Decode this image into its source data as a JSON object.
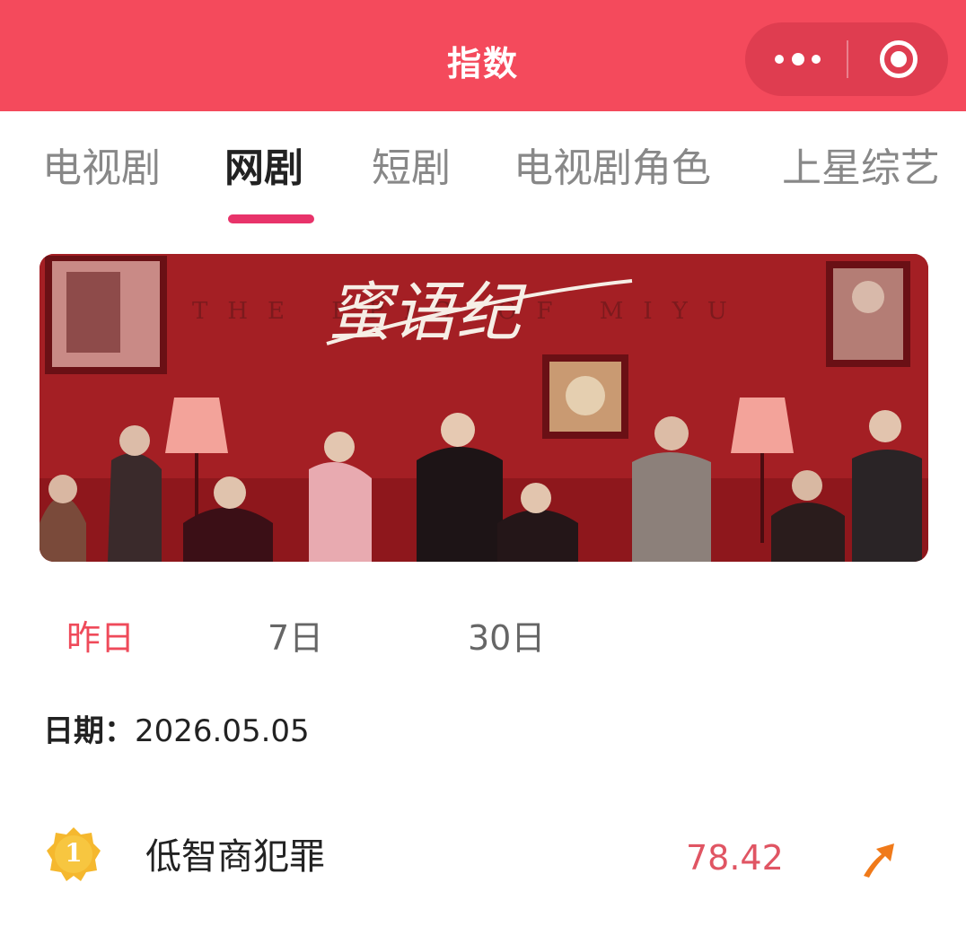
{
  "header": {
    "title": "指数",
    "bg_color": "#f44a5c"
  },
  "category_tabs": [
    {
      "label": "电视剧",
      "active": false
    },
    {
      "label": "网剧",
      "active": true
    },
    {
      "label": "短剧",
      "active": false
    },
    {
      "label": "电视剧角色",
      "active": false
    },
    {
      "label": "上星综艺",
      "active": false
    }
  ],
  "banner": {
    "title_text": "蜜语纪",
    "subtitle_text": "THE EPIC OF MIYU"
  },
  "period_tabs": [
    {
      "label": "昨日",
      "active": true
    },
    {
      "label": "7日",
      "active": false
    },
    {
      "label": "30日",
      "active": false
    }
  ],
  "date": {
    "label": "日期：",
    "value": "2026.05.05"
  },
  "ranking": [
    {
      "rank": "1",
      "name": "低智商犯罪",
      "score": "78.42",
      "trend": "up-arrow-icon"
    }
  ],
  "colors": {
    "accent": "#e8336a",
    "active_period": "#ef4a5a",
    "score": "#e05563",
    "badge_gold": "#f5b82e",
    "trend_orange": "#f07a1a"
  }
}
